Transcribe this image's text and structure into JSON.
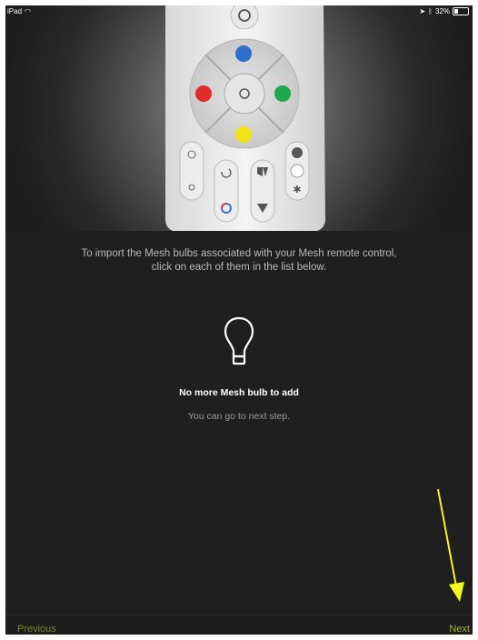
{
  "status_bar": {
    "device": "iPad",
    "battery": "32%",
    "battery_level": 0.32
  },
  "hero": {
    "description_icon": "mesh-remote-control-image",
    "button_colors": {
      "top": "#2f6fc9",
      "left": "#e32b2b",
      "right": "#1fa84a",
      "bottom": "#f2e313"
    }
  },
  "content": {
    "instruction_line1": "To import the Mesh bulbs associated with your Mesh remote control,",
    "instruction_line2": "click on each of them in the list below.",
    "empty_title": "No more Mesh bulb to add",
    "empty_subtitle": "You can go to next step."
  },
  "bottom_bar": {
    "previous_label": "Previous",
    "next_label": "Next"
  },
  "colors": {
    "background": "#1f1f1f",
    "accent": "#a0b530",
    "annotation_arrow": "#f5f51e"
  }
}
